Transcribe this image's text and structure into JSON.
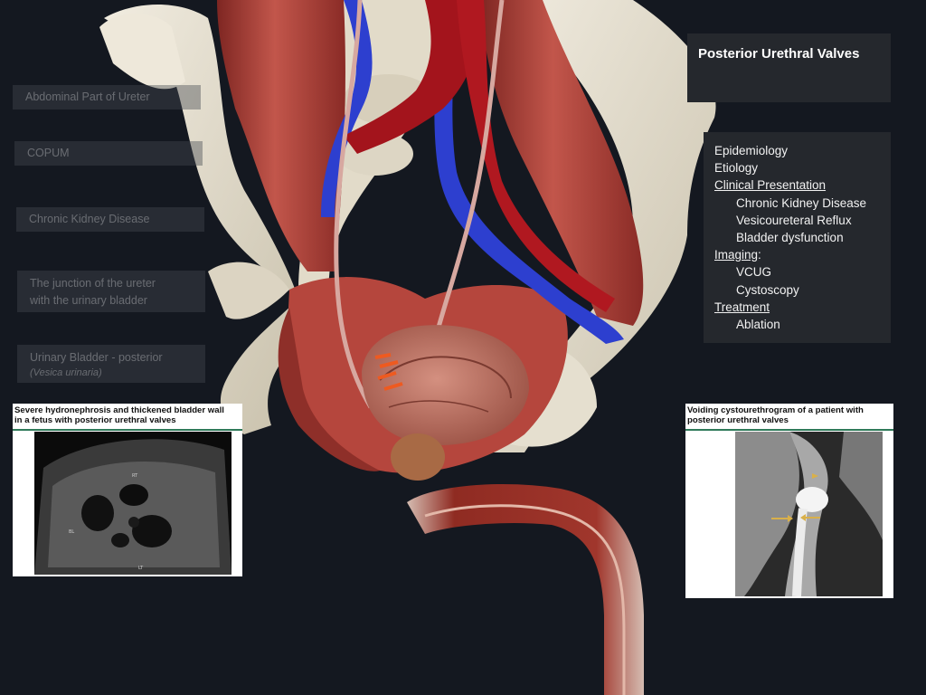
{
  "labels": {
    "abdominal_ureter": "Abdominal Part of Ureter",
    "copum": "COPUM",
    "ckd": "Chronic Kidney Disease",
    "junction_line1": "The junction of the ureter",
    "junction_line2": "with the urinary bladder",
    "bladder_posterior": "Urinary Bladder - posterior",
    "bladder_latin": "(Vesica urinaria)"
  },
  "title_panel": {
    "title": "Posterior Urethral Valves"
  },
  "contents": {
    "epidemiology": "Epidemiology",
    "etiology": "Etiology",
    "clinical_presentation": "Clinical Presentation",
    "chronic_kidney_disease": "Chronic Kidney Disease",
    "vesicoureteral_reflux": "Vesicoureteral Reflux",
    "bladder_dysfunction": "Bladder dysfunction",
    "imaging": "Imaging",
    "imaging_colon": ":",
    "vcug": "VCUG",
    "cystoscopy": "Cystoscopy",
    "treatment": "Treatment",
    "ablation": "Ablation"
  },
  "ultrasound_card": {
    "caption_line1": "Severe hydronephrosis and thickened bladder wall",
    "caption_line2": "in a fetus with posterior urethral valves",
    "mark_rt": "RT",
    "mark_bl": "BL",
    "mark_lt": "LT"
  },
  "vcug_card": {
    "caption_line1": "Voiding cystourethrogram of a patient with",
    "caption_line2": "posterior urethral valves"
  },
  "colors": {
    "background": "#141820",
    "panel": "#25282d",
    "muscle": "#b3443c",
    "bone": "#e6e0d0",
    "artery": "#a3141c",
    "vein": "#2d3fcf",
    "caption_rule": "#2f7a5a",
    "arrow": "#d9b04a"
  }
}
